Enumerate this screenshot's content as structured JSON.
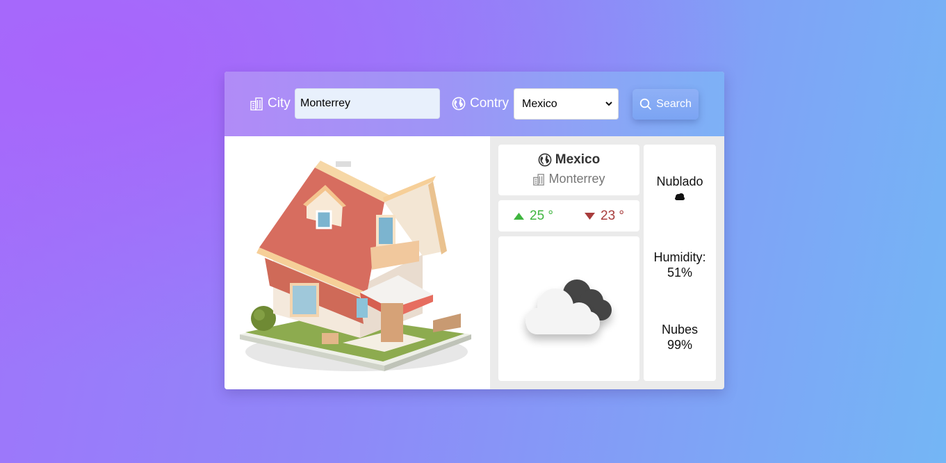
{
  "search": {
    "city_label": "City",
    "city_value": "Monterrey",
    "country_label": "Contry",
    "country_selected": "Mexico",
    "button_label": "Search"
  },
  "location": {
    "country": "Mexico",
    "city": "Monterrey"
  },
  "temperature": {
    "max": "25 °",
    "min": "23 °"
  },
  "details": {
    "description": "Nublado",
    "humidity_label": "Humidity:",
    "humidity_value": "51%",
    "clouds_label": "Nubes",
    "clouds_value": "99%"
  },
  "icons": {
    "city": "building-icon",
    "country": "globe-icon",
    "search": "search-icon",
    "max": "arrow-up-icon",
    "min": "arrow-down-icon",
    "weather": "cloud-icon"
  },
  "colors": {
    "temp_max": "#3fb53f",
    "temp_min": "#a83c3c",
    "topbar_start": "#b18bf7",
    "topbar_end": "#7db1f6"
  }
}
